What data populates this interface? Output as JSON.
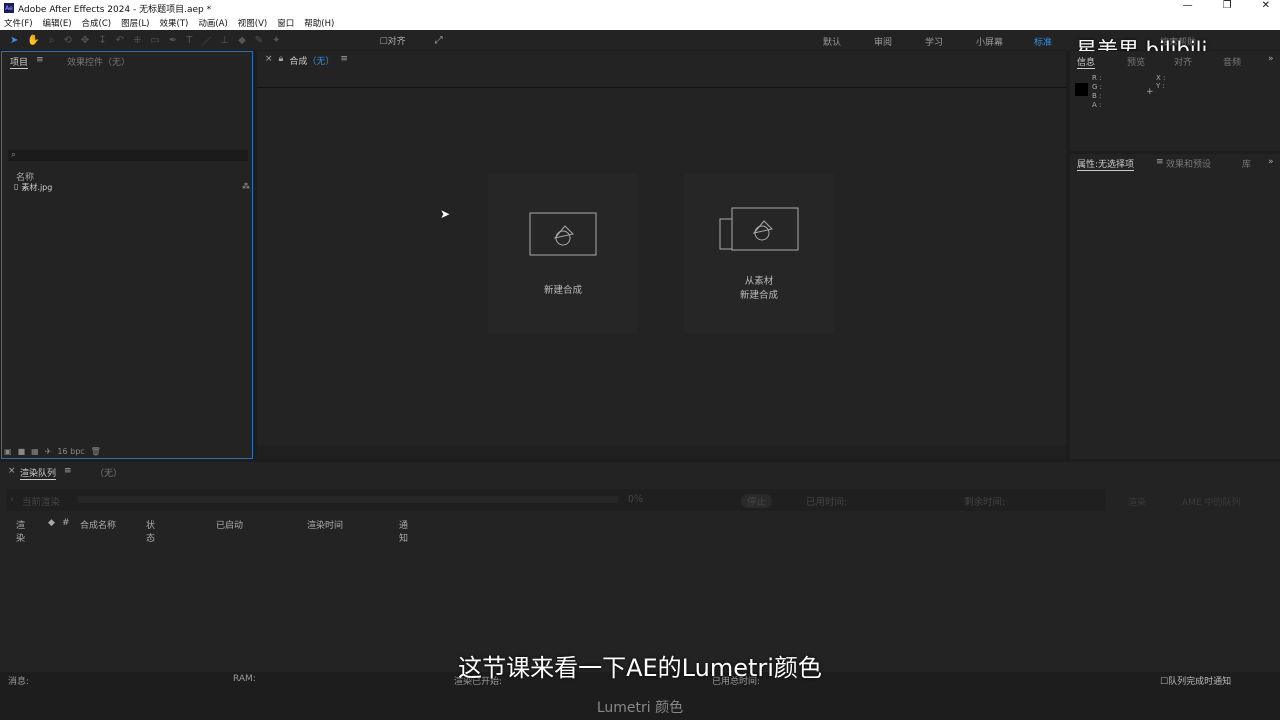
{
  "window": {
    "title": "Adobe After Effects 2024 - 无标题项目.aep *",
    "logo": "Ae",
    "min": "—",
    "restore": "❐",
    "close": "✕"
  },
  "menu": [
    "文件(F)",
    "编辑(E)",
    "合成(C)",
    "图层(L)",
    "效果(T)",
    "动画(A)",
    "视图(V)",
    "窗口",
    "帮助(H)"
  ],
  "toolbar": {
    "snap": "对齐"
  },
  "workspaces": [
    "默认",
    "审阅",
    "学习",
    "小屏幕",
    "标准"
  ],
  "search_help": "搜索帮助",
  "watermark": "星美男 bilibili",
  "project_panel": {
    "tabs": [
      "项目",
      "效果控件（无）"
    ],
    "search_placeholder": "",
    "column": "名称",
    "items": [
      "素材.jpg"
    ],
    "bpc": "16 bpc"
  },
  "comp_panel": {
    "tab": "合成",
    "tab_value": "（无）",
    "cards": [
      {
        "label": "新建合成"
      },
      {
        "label_line1": "从素材",
        "label_line2": "新建合成"
      }
    ]
  },
  "info_panel": {
    "tabs": [
      "信息",
      "预览",
      "对齐",
      "音频"
    ],
    "labels": [
      "R :",
      "G :",
      "B :",
      "A :"
    ],
    "xy": [
      "X :",
      "Y :"
    ]
  },
  "props_panel": {
    "tabs": [
      "属性:无选择项",
      "效果和预设",
      "库"
    ]
  },
  "render_queue": {
    "tab": "渲染队列",
    "tab2": "（无）",
    "current": "当前渲染",
    "percent": "0%",
    "stop": "停止",
    "elapsed": "已用时间:",
    "remaining": "剩余时间:",
    "render_btn": "渲染",
    "ame_btn": "AME 中的队列",
    "columns": [
      "渲染",
      "#",
      "合成名称",
      "状态",
      "已启动",
      "渲染时间",
      "通知"
    ]
  },
  "status": {
    "message": "消息:",
    "ram": "RAM:",
    "started": "渲染已开始:",
    "total": "已用总时间:",
    "notify": "队列完成时通知"
  },
  "subtitle": "这节课来看一下AE的Lumetri颜色",
  "caption": "Lumetri 颜色"
}
